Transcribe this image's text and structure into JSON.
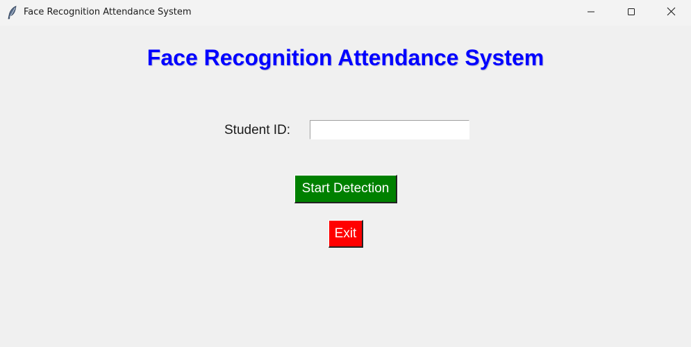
{
  "window": {
    "title": "Face Recognition Attendance System",
    "icon": "feather-icon",
    "controls": [
      "minimize-icon",
      "maximize-icon",
      "close-icon"
    ]
  },
  "main": {
    "heading": "Face Recognition Attendance System",
    "heading_color": "#0000ff",
    "student_id_label": "Student ID:",
    "student_id_value": "",
    "start_button_label": "Start Detection",
    "start_button_color": "#008000",
    "exit_button_label": "Exit",
    "exit_button_color": "#ff0000"
  }
}
